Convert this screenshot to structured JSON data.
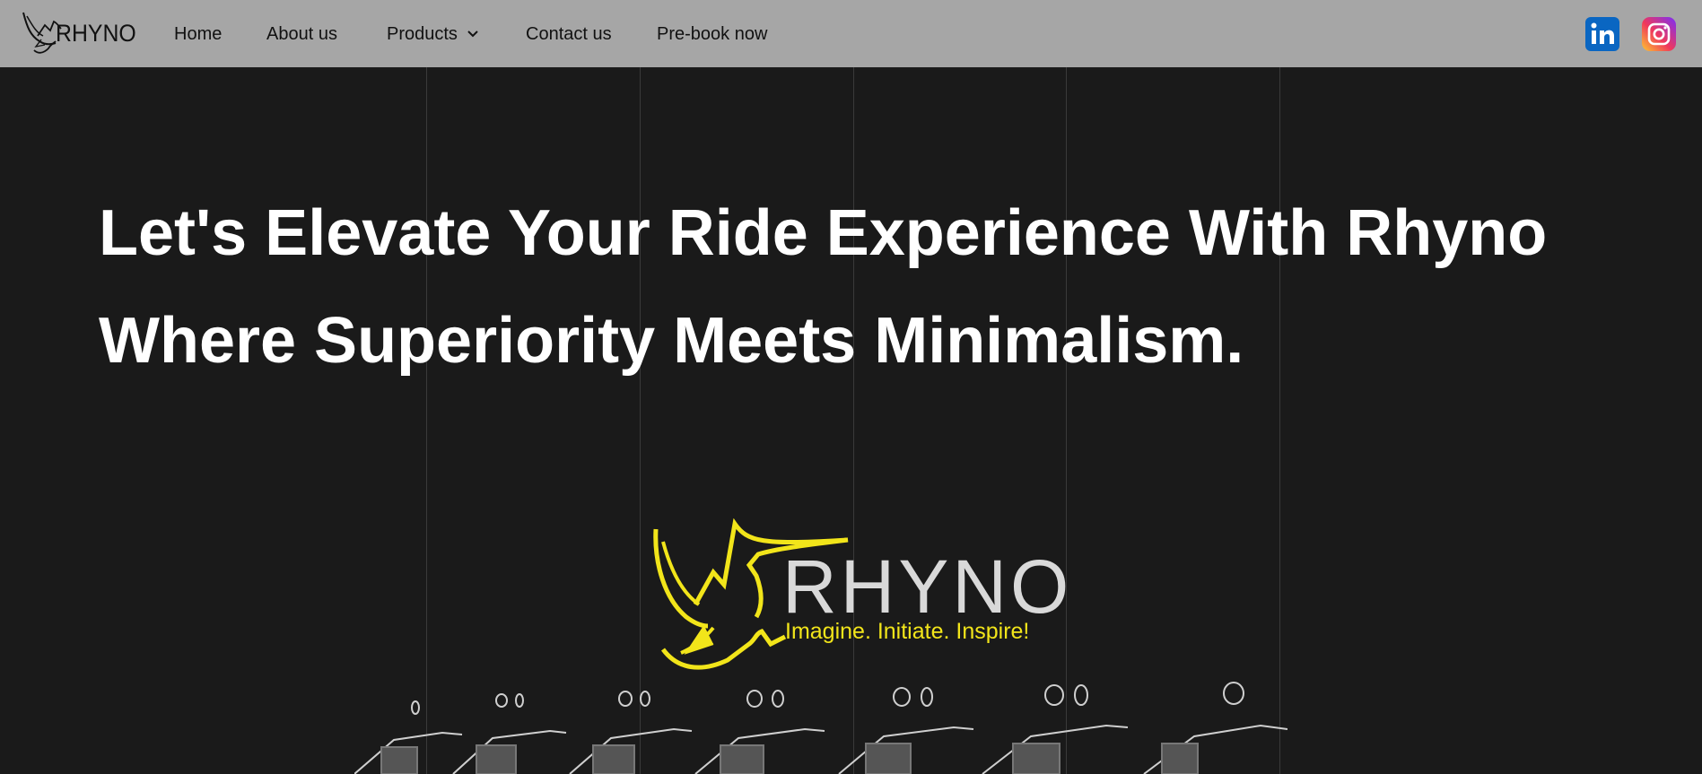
{
  "brand": {
    "logo_text": "RHYNO"
  },
  "nav": {
    "items": [
      {
        "label": "Home"
      },
      {
        "label": "About us"
      },
      {
        "label": "Products"
      },
      {
        "label": "Contact us"
      },
      {
        "label": "Pre-book now"
      }
    ]
  },
  "social": {
    "icons": [
      "linkedin-icon",
      "instagram-icon"
    ],
    "linkedin_label": "in"
  },
  "hero": {
    "title_line1": "Let's Elevate Your Ride Experience With Rhyno",
    "title_line2": "Where Superiority Meets Minimalism."
  },
  "hero_logo": {
    "word": "RHYNO",
    "tagline": "Imagine. Initiate. Inspire!"
  },
  "colors": {
    "navbar": "#a6a6a6",
    "background": "#1a1a1a",
    "accent_yellow": "#f2e51a",
    "linkedin": "#0a66c2"
  }
}
